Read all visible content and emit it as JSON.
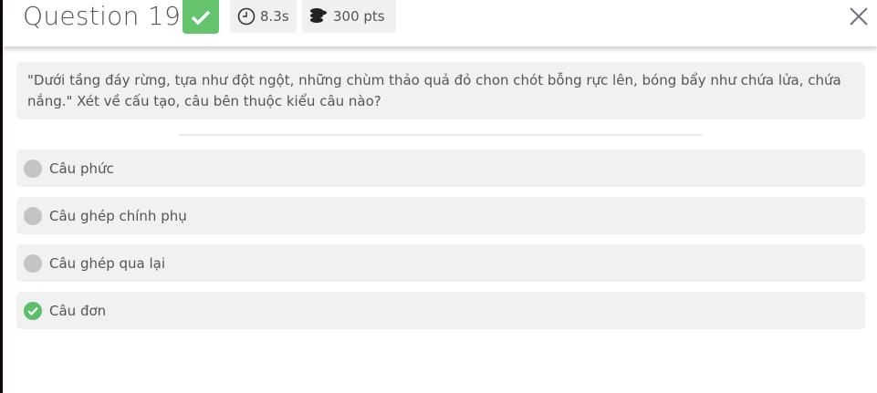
{
  "header": {
    "title": "Question 19",
    "status_icon": "check-icon",
    "status_color": "#63c46d",
    "time": "8.3s",
    "points": "300 pts"
  },
  "question": {
    "text": "\"Dưới tầng đáy rừng, tựa như đột ngột, những chùm thảo quả đỏ chon chót bỗng rực lên, bóng bẩy như chứa lửa, chứa nắng.\" Xét về cấu tạo, câu bên thuộc kiểu câu nào?"
  },
  "options": [
    {
      "label": "Câu phức",
      "correct": false
    },
    {
      "label": "Câu ghép chính phụ",
      "correct": false
    },
    {
      "label": "Câu ghép qua lại",
      "correct": false
    },
    {
      "label": "Câu đơn",
      "correct": true
    }
  ]
}
